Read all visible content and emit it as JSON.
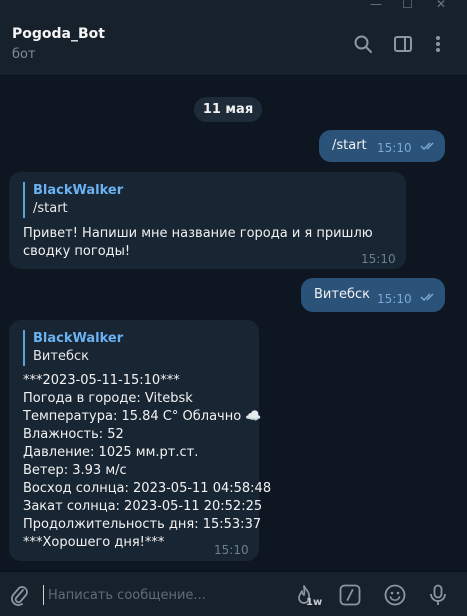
{
  "header": {
    "title": "Pogoda_Bot",
    "subtitle": "бот"
  },
  "chat": {
    "date_label": "11 мая",
    "messages": [
      {
        "direction": "out",
        "text": "/start",
        "time": "15:10",
        "status": "read"
      },
      {
        "direction": "in",
        "reply_to": {
          "author": "BlackWalker",
          "text": "/start"
        },
        "text": "Привет! Напиши мне название города и я пришлю\nсводку погоды!",
        "time": "15:10"
      },
      {
        "direction": "out",
        "text": "Витебск",
        "time": "15:10",
        "status": "read"
      },
      {
        "direction": "in",
        "reply_to": {
          "author": "BlackWalker",
          "text": "Витебск"
        },
        "text": "***2023-05-11-15:10***\nПогода в городе: Vitebsk\nТемпература: 15.84 C° Облачно ☁️\nВлажность: 52\nДавление: 1025 мм.рт.ст.\nВетер: 3.93 м/с\nВосход солнца: 2023-05-11 04:58:48\nЗакат солнца: 2023-05-11 20:52:25\nПродолжительность дня: 15:53:37\n***Хорошего дня!***",
        "time": "15:10"
      }
    ]
  },
  "composer": {
    "placeholder": "Написать сообщение...",
    "emoji_badge": "1w"
  },
  "colors": {
    "background": "#0e1621",
    "header": "#17212b",
    "outgoing_bubble": "#2b5278",
    "incoming_bubble": "#182533",
    "accent": "#6ab2f2"
  },
  "icons": [
    "minimize-icon",
    "maximize-icon",
    "close-icon",
    "search-icon",
    "sidebar-toggle-icon",
    "more-vertical-icon",
    "paperclip-icon",
    "fire-icon",
    "command-icon",
    "emoji-icon",
    "microphone-icon",
    "double-check-icon"
  ]
}
